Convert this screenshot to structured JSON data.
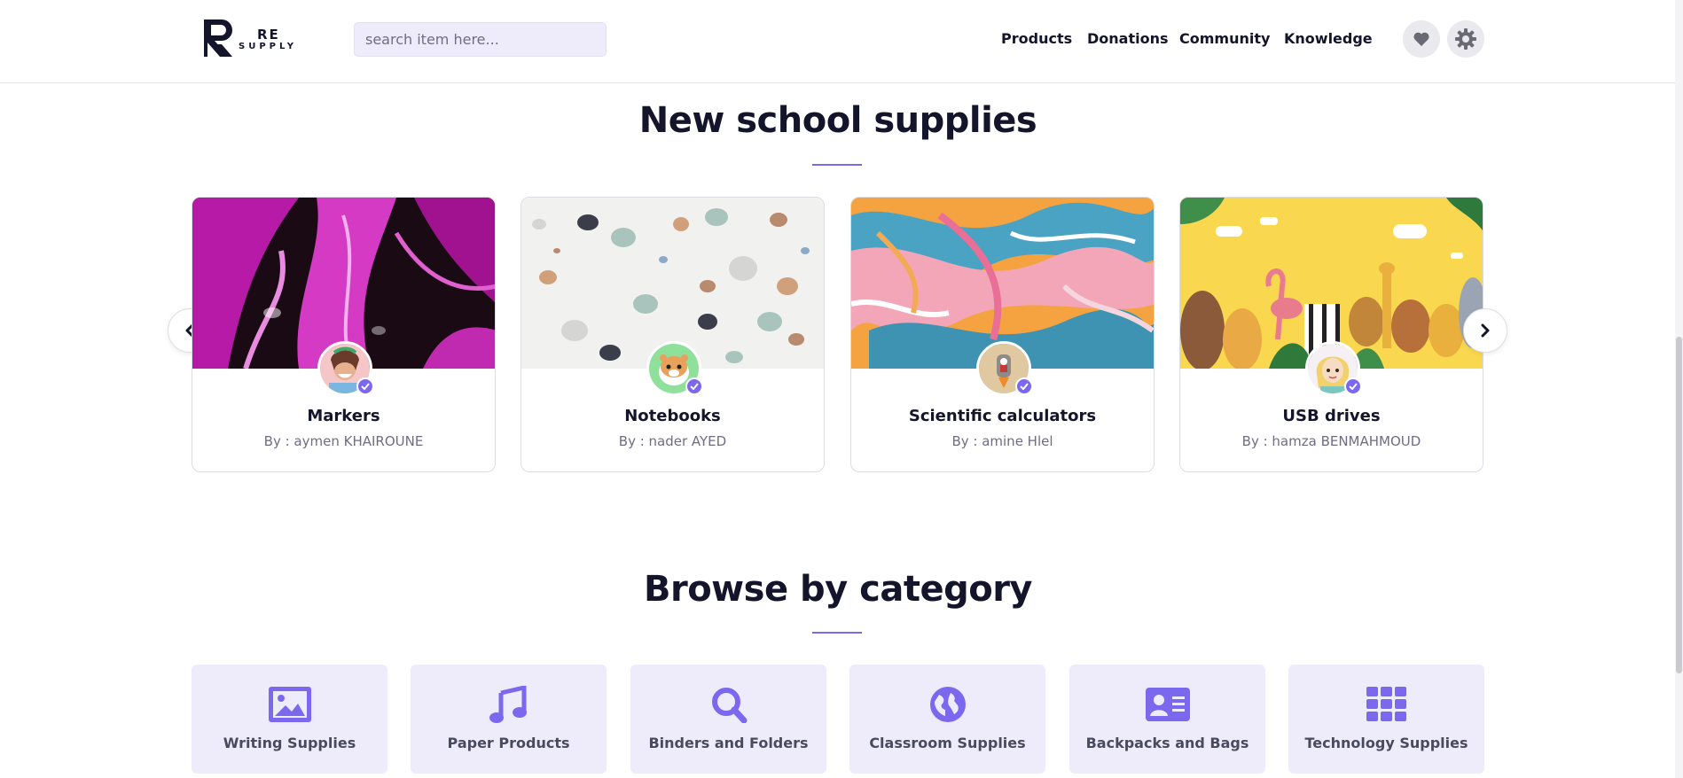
{
  "header": {
    "logo": {
      "line1": "RE",
      "line2": "SUPPLY"
    },
    "search": {
      "placeholder": "search item here..."
    },
    "nav": [
      "Products",
      "Donations",
      "Community",
      "Knowledge"
    ],
    "icons": [
      "heart-icon",
      "gear-icon"
    ]
  },
  "supplies": {
    "title": "New school supplies",
    "cards": [
      {
        "title": "Markers",
        "author": "By : aymen KHAIROUNE",
        "image": "pink-marble-pattern",
        "avatar": "woman-photo"
      },
      {
        "title": "Notebooks",
        "author": "By : nader AYED",
        "image": "terrazzo-pattern",
        "avatar": "hamster-cartoon"
      },
      {
        "title": "Scientific calculators",
        "author": "By : amine Hlel",
        "image": "colorful-brush-strokes",
        "avatar": "rocket-character"
      },
      {
        "title": "USB drives",
        "author": "By : hamza BENMAHMOUD",
        "image": "jungle-animals-illustration",
        "avatar": "blonde-girl-cartoon"
      }
    ],
    "arrows": [
      "chevron-left-icon",
      "chevron-right-icon"
    ]
  },
  "categories": {
    "title": "Browse by category",
    "items": [
      {
        "label": "Writing Supplies",
        "icon": "image-icon"
      },
      {
        "label": "Paper Products",
        "icon": "music-note-icon"
      },
      {
        "label": "Binders and Folders",
        "icon": "magnifier-icon"
      },
      {
        "label": "Classroom Supplies",
        "icon": "globe-icon"
      },
      {
        "label": "Backpacks and Bags",
        "icon": "id-card-icon"
      },
      {
        "label": "Technology Supplies",
        "icon": "grid-icon"
      }
    ]
  },
  "colors": {
    "accent": "#7b68ee",
    "tile_bg": "#eeecfb",
    "text_dark": "#14142b",
    "text_muted": "#6e6d85"
  }
}
